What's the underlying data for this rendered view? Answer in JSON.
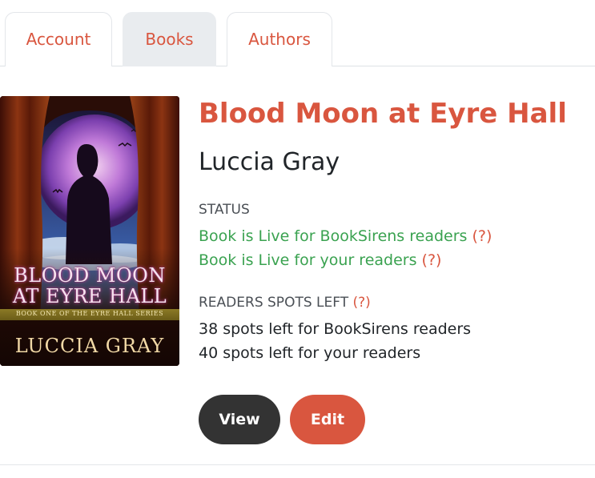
{
  "tabs": [
    {
      "label": "Account",
      "active": false
    },
    {
      "label": "Books",
      "active": true
    },
    {
      "label": "Authors",
      "active": false
    }
  ],
  "book": {
    "cover": {
      "title_line1": "BLOOD MOON",
      "title_line2": "AT EYRE HALL",
      "series": "BOOK ONE OF THE EYRE HALL SERIES",
      "author": "LUCCIA GRAY"
    },
    "title": "Blood Moon at Eyre Hall",
    "author": "Luccia Gray",
    "status_label": "STATUS",
    "status_lines": [
      "Book is Live for BookSirens readers",
      "Book is Live for your readers"
    ],
    "spots_label": "READERS SPOTS LEFT",
    "spots_lines": [
      "38 spots left for BookSirens readers",
      "40 spots left for your readers"
    ],
    "help_text": "(?)"
  },
  "actions": {
    "view_label": "View",
    "edit_label": "Edit"
  },
  "colors": {
    "accent": "#d9563f",
    "status_green": "#3aa250",
    "view_button": "#333333",
    "active_tab_bg": "#e9ecef"
  }
}
